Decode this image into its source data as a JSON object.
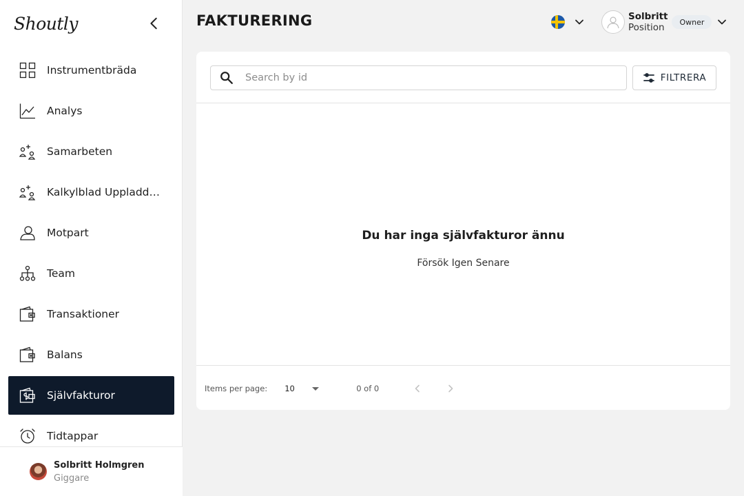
{
  "sidebar": {
    "logo": "Shoutly",
    "items": [
      {
        "label": "Instrumentbräda",
        "icon": "dashboard-icon"
      },
      {
        "label": "Analys",
        "icon": "chart-line-icon"
      },
      {
        "label": "Samarbeten",
        "icon": "people-add-icon"
      },
      {
        "label": "Kalkylblad Uppladdning",
        "icon": "people-add-icon"
      },
      {
        "label": "Motpart",
        "icon": "person-icon"
      },
      {
        "label": "Team",
        "icon": "hierarchy-icon"
      },
      {
        "label": "Transaktioner",
        "icon": "wallet-icon"
      },
      {
        "label": "Balans",
        "icon": "wallet-icon"
      },
      {
        "label": "Självfakturor",
        "icon": "invoice-dollar-icon",
        "active": true
      },
      {
        "label": "Tidtappar",
        "icon": "clock-icon"
      }
    ],
    "user": {
      "name": "Solbritt Holmgren",
      "role": "Giggare"
    }
  },
  "header": {
    "title": "FAKTURERING",
    "language": "sv",
    "profile": {
      "name": "Solbritt",
      "position": "Position",
      "role_badge": "Owner"
    }
  },
  "main": {
    "search": {
      "placeholder": "Search by id",
      "value": ""
    },
    "filter_label": "FILTRERA",
    "empty_title": "Du har inga självfakturor ännu",
    "empty_subtitle": "Försök Igen Senare",
    "pagination": {
      "items_per_page_label": "Items per page:",
      "items_per_page": "10",
      "range": "0 of 0"
    }
  },
  "colors": {
    "active_nav_bg": "#0e1a2b",
    "page_bg": "#f2f2f2"
  }
}
